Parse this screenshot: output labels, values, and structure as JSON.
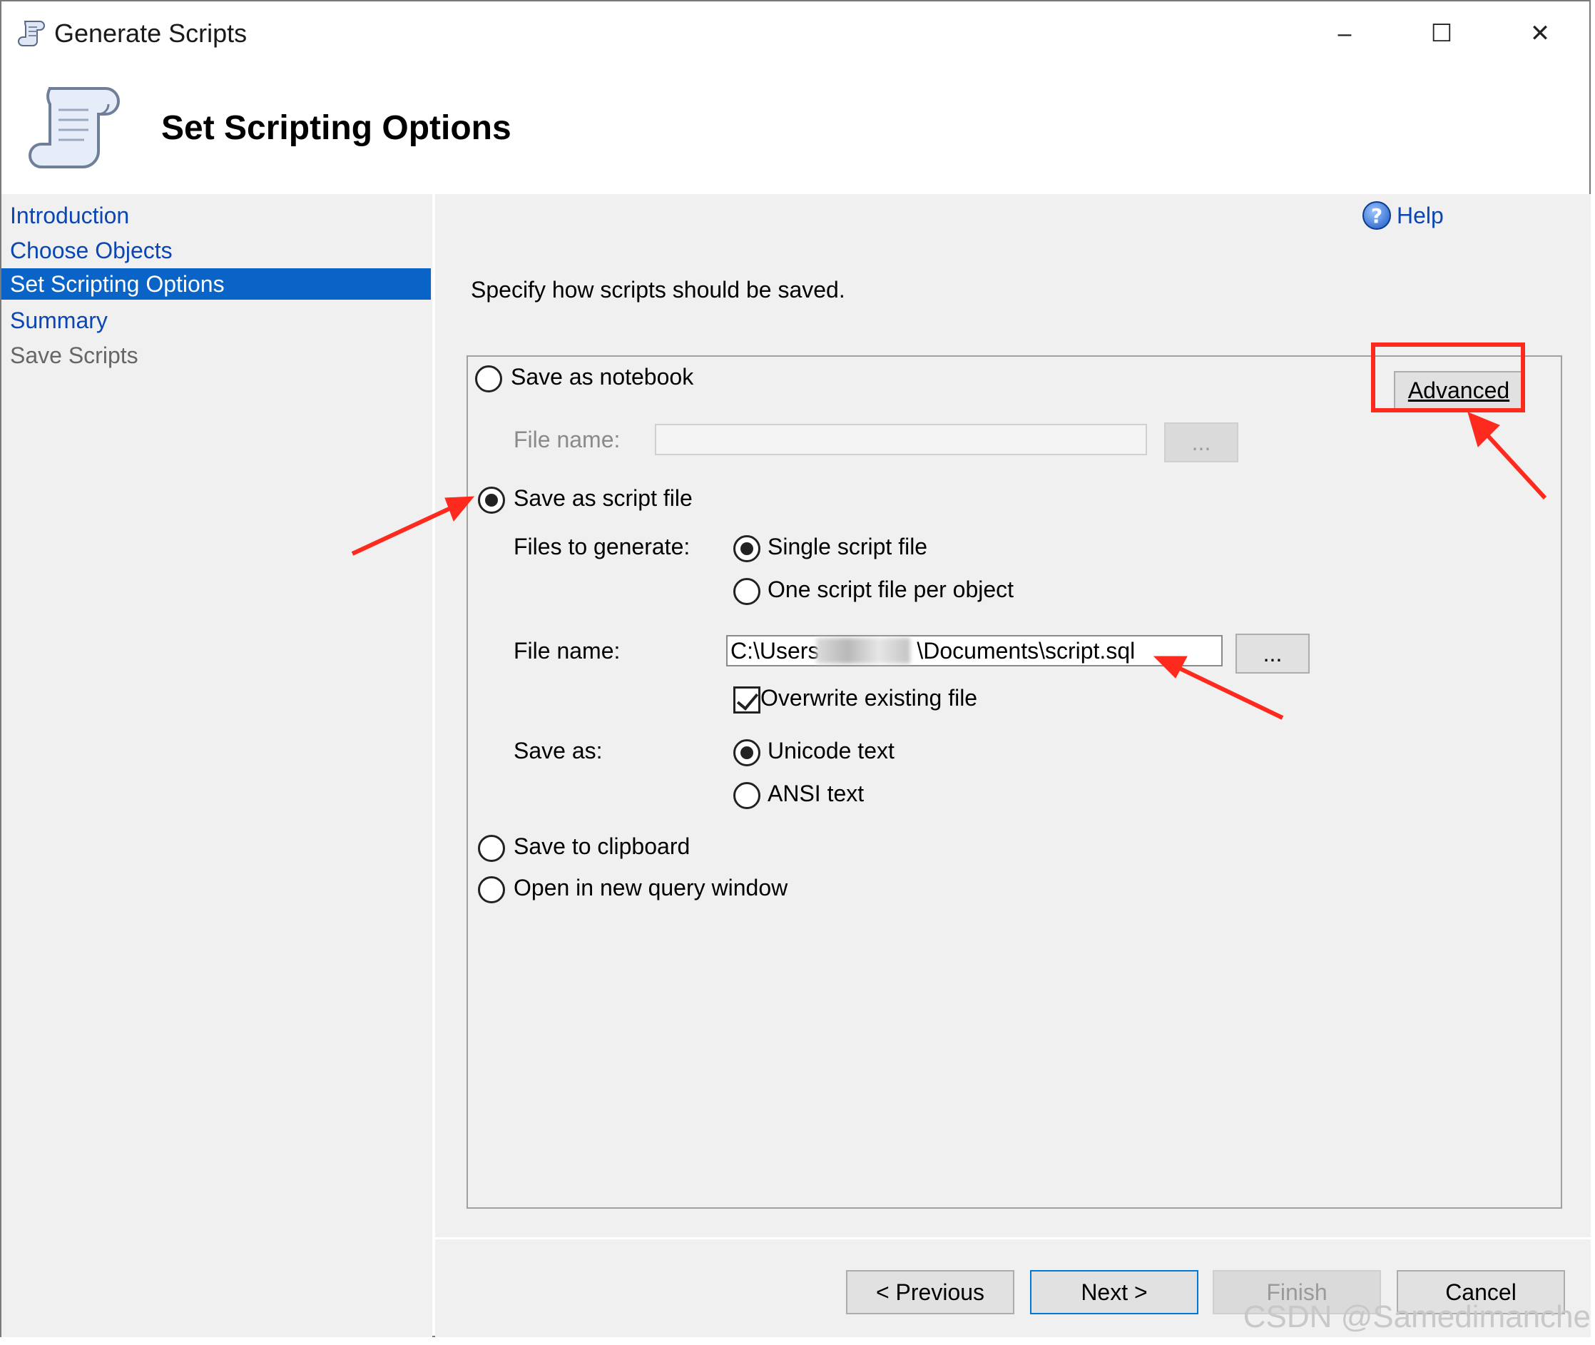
{
  "window": {
    "title": "Generate Scripts",
    "minimize": "–",
    "maximize": "☐",
    "close": "✕"
  },
  "header": {
    "title": "Set Scripting Options"
  },
  "nav": {
    "items": [
      {
        "label": "Introduction",
        "state": "link"
      },
      {
        "label": "Choose Objects",
        "state": "link"
      },
      {
        "label": "Set Scripting Options",
        "state": "active"
      },
      {
        "label": "Summary",
        "state": "link"
      },
      {
        "label": "Save Scripts",
        "state": "disabled"
      }
    ]
  },
  "main": {
    "help_label": "Help",
    "help_glyph": "?",
    "instructions": "Specify how scripts should be saved.",
    "advanced_label": "Advanced",
    "notebook": {
      "label": "Save as notebook",
      "file_name_label": "File name:",
      "file_name_value": "",
      "browse_label": "..."
    },
    "script_file": {
      "label": "Save as script file",
      "files_to_generate_label": "Files to generate:",
      "single_label": "Single script file",
      "per_object_label": "One script file per object",
      "file_name_label": "File name:",
      "file_name_value": "C:\\Users\\    \\Documents\\script.sql",
      "browse_label": "...",
      "overwrite_label": "Overwrite existing file",
      "save_as_label": "Save as:",
      "unicode_label": "Unicode text",
      "ansi_label": "ANSI text"
    },
    "clipboard_label": "Save to clipboard",
    "query_window_label": "Open in new query window"
  },
  "footer": {
    "previous_label": "< Previous",
    "next_label": "Next >",
    "finish_label": "Finish",
    "cancel_label": "Cancel"
  },
  "watermark": "CSDN @Samedimanche",
  "colors": {
    "accent": "#0A64C8",
    "link": "#0A46B4",
    "annotation": "#FF2A1E"
  }
}
